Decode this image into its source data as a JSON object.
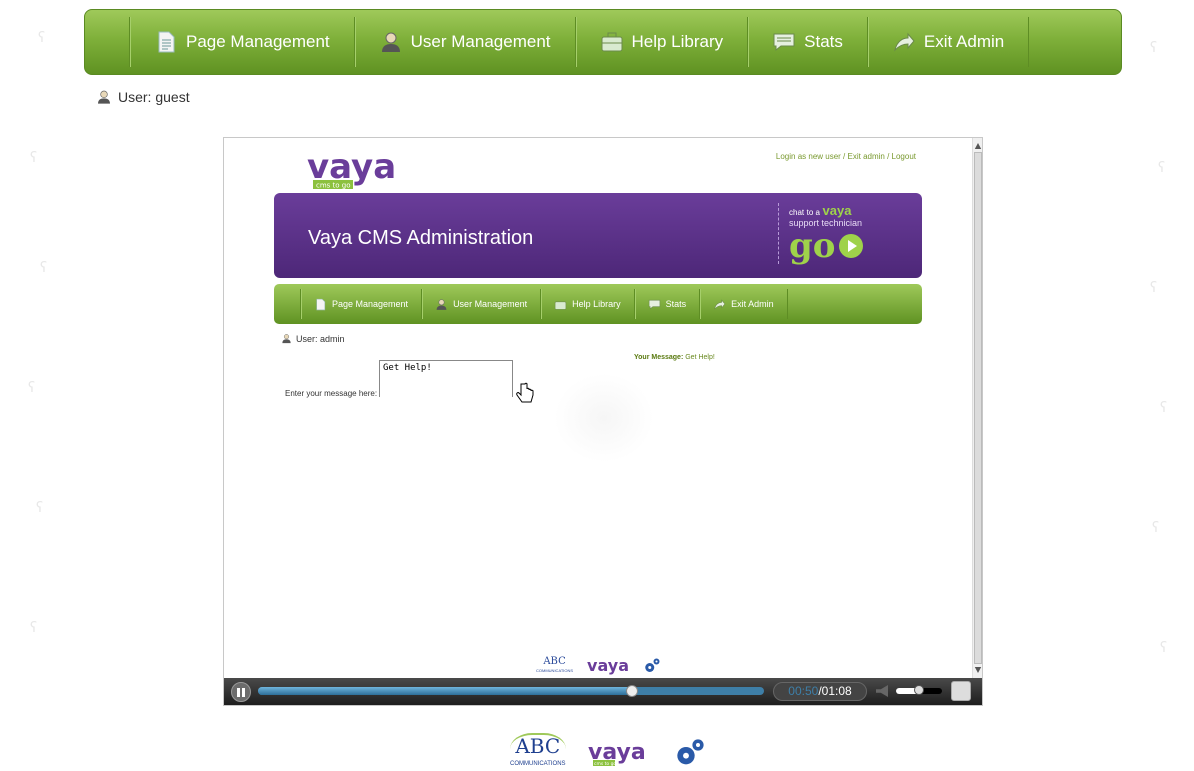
{
  "nav": {
    "items": [
      {
        "label": "Page Management",
        "icon": "page-icon"
      },
      {
        "label": "User Management",
        "icon": "user-icon"
      },
      {
        "label": "Help Library",
        "icon": "briefcase-icon"
      },
      {
        "label": "Stats",
        "icon": "chat-bubble-icon"
      },
      {
        "label": "Exit Admin",
        "icon": "exit-arrow-icon"
      }
    ]
  },
  "user": {
    "label": "User: guest"
  },
  "video": {
    "top_links": "Login as new user / Exit admin / Logout",
    "logo_text": "vaya",
    "logo_tagline": "cms to go",
    "banner_title": "Vaya CMS Administration",
    "chat": {
      "prefix": "chat",
      "to_a": "to a",
      "brand": "vaya",
      "line2": "support technician",
      "go": "go"
    },
    "subnav": [
      {
        "label": "Page Management"
      },
      {
        "label": "User Management"
      },
      {
        "label": "Help Library"
      },
      {
        "label": "Stats"
      },
      {
        "label": "Exit Admin"
      }
    ],
    "user_label": "User: admin",
    "message_label": "Enter your message here:",
    "message_value": "Get Help!",
    "your_message_label": "Your Message:",
    "your_message_value": "Get Help!",
    "footer": {
      "abc": "ABC",
      "abc_sub": "COMMUNICATIONS",
      "vaya": "vaya"
    }
  },
  "player": {
    "current_time": "00:50",
    "separator": "/",
    "total_time": "01:08",
    "progress": 0.74,
    "volume": 0.5
  },
  "footer": {
    "abc": "ABC",
    "abc_sub": "COMMUNICATIONS",
    "vaya": "vaya",
    "vaya_tag": "cms to go"
  },
  "colors": {
    "nav_green": "#7fb03a",
    "banner_purple": "#5a2f88",
    "player_blue": "#3e7fa8"
  }
}
